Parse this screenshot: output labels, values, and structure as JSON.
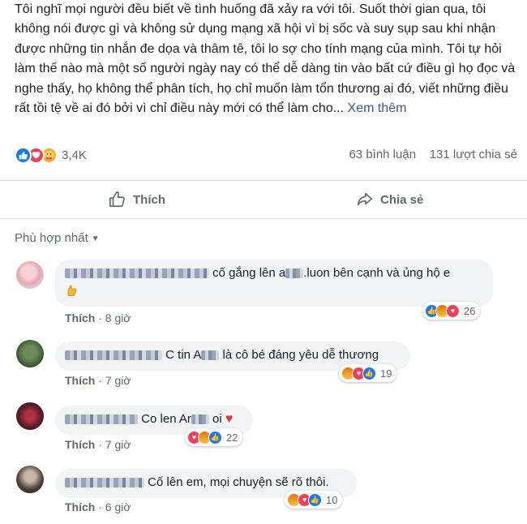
{
  "post": {
    "text": "Tôi nghĩ mọi người đều biết về tình huống đã xảy ra với tôi. Suốt thời gian qua, tôi không nói được gì và không sử dụng mạng xã hội vì bị sốc và suy sụp sau khi nhận được những tin nhắn đe dọa và thâm tê, tôi lo sợ cho tính mạng của mình. Tôi tự hỏi làm thế nào mà một số người ngày nay có thể dễ dàng tin vào bất cứ điều gì họ đọc và nghe thấy, họ không thể phân tích, họ chỉ muốn làm tổn thương ai đó, viết những điều rất tồi tệ về ai đó bởi vì chỉ điều này mới có thể làm cho...",
    "see_more": "Xem thêm"
  },
  "stats": {
    "reaction_count": "3,4K",
    "comments": "63 bình luận",
    "shares": "131 lượt chia sẻ",
    "reaction_icons": [
      "like-icon",
      "love-icon",
      "care-icon"
    ]
  },
  "actions": {
    "like": "Thích",
    "share": "Chia sẻ"
  },
  "filter": {
    "label": "Phù hợp nhất"
  },
  "comments": [
    {
      "text_after_name": ".luon bên cạnh và ủng hộ e",
      "text_prefix": "cố gắng lên a",
      "like_label": "Thích",
      "time": "8 giờ",
      "reaction_count": "26",
      "reaction_icons": [
        "like-icon",
        "angry-icon",
        "love-icon"
      ],
      "emoji": "hand-emoji"
    },
    {
      "text_prefix": "C tin A",
      "text_after_name": "là cô bé đáng yêu dễ thương",
      "like_label": "Thích",
      "time": "7 giờ",
      "reaction_count": "19",
      "reaction_icons": [
        "angry-icon",
        "love-icon",
        "like-icon"
      ]
    },
    {
      "text_prefix": "Co len Ar",
      "text_after_name": "oi",
      "like_label": "Thích",
      "time": "7 giờ",
      "reaction_count": "22",
      "reaction_icons": [
        "love-icon",
        "angry-icon",
        "like-icon"
      ],
      "emoji": "heart-emoji"
    },
    {
      "text_after_name": "Cố lên em, mọi chuyện sẽ rõ thôi.",
      "like_label": "Thích",
      "time": "6 giờ",
      "reaction_count": "10",
      "reaction_icons": [
        "angry-icon",
        "love-icon",
        "like-icon"
      ]
    }
  ],
  "colors": {
    "link": "#385898",
    "secondary_text": "#606770",
    "bubble": "#f2f3f5",
    "like": "#1877f2",
    "love": "#f33e58"
  }
}
